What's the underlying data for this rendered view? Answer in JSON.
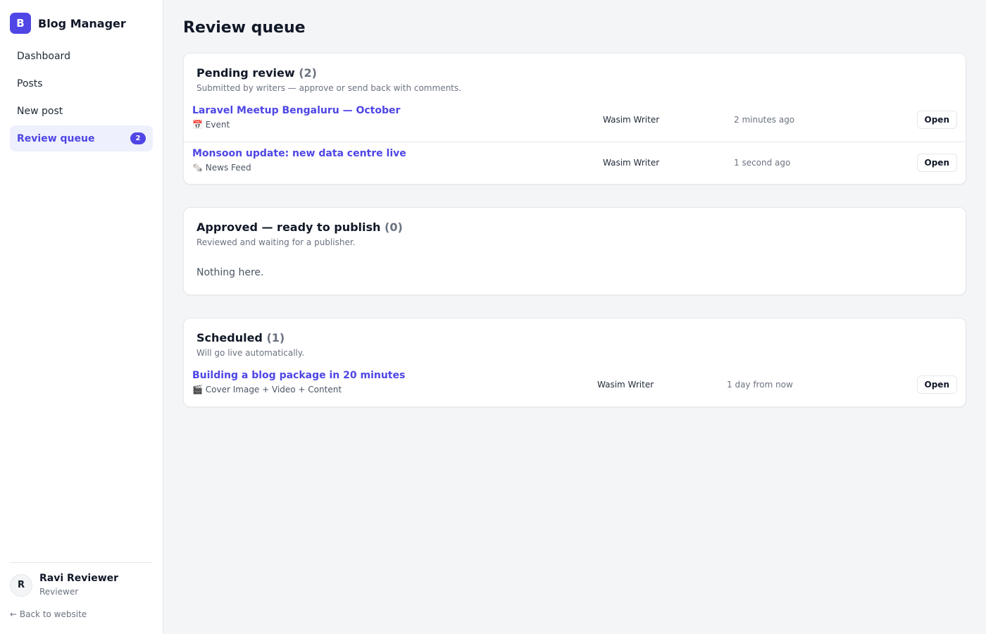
{
  "brand": {
    "logo_letter": "B",
    "name": "Blog Manager",
    "accent": "#4f46e5"
  },
  "nav": [
    {
      "label": "Dashboard"
    },
    {
      "label": "Posts"
    },
    {
      "label": "New post"
    },
    {
      "label": "Review queue",
      "badge": "2",
      "active": true
    }
  ],
  "user": {
    "initial": "R",
    "name": "Ravi Reviewer",
    "role": "Reviewer"
  },
  "back_link": "← Back to website",
  "page_title": "Review queue",
  "sections": {
    "pending": {
      "title": "Pending review",
      "count": "(2)",
      "subtitle": "Submitted by writers — approve or send back with comments.",
      "rows": [
        {
          "title": "Laravel Meetup Bengaluru — October",
          "meta_icon": "📅",
          "meta": "Event",
          "author": "Wasim Writer",
          "time": "2 minutes ago",
          "action": "Open"
        },
        {
          "title": "Monsoon update: new data centre live",
          "meta_icon": "🗞️",
          "meta": "News Feed",
          "author": "Wasim Writer",
          "time": "1 second ago",
          "action": "Open"
        }
      ]
    },
    "approved": {
      "title": "Approved — ready to publish",
      "count": "(0)",
      "subtitle": "Reviewed and waiting for a publisher.",
      "empty": "Nothing here."
    },
    "scheduled": {
      "title": "Scheduled",
      "count": "(1)",
      "subtitle": "Will go live automatically.",
      "rows": [
        {
          "title": "Building a blog package in 20 minutes",
          "meta_icon": "🎬",
          "meta": "Cover Image + Video + Content",
          "author": "Wasim Writer",
          "time": "1 day from now",
          "action": "Open"
        }
      ]
    }
  }
}
